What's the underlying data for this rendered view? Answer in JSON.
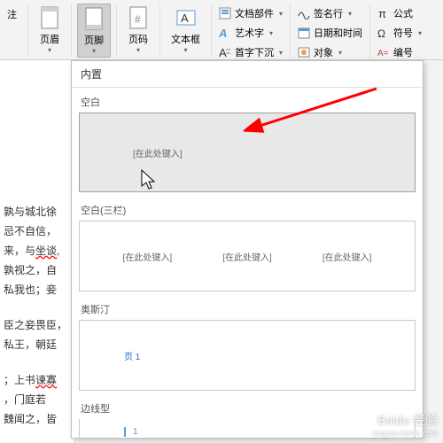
{
  "ribbon": {
    "note_frag": "注",
    "header": "页眉",
    "footer": "页脚",
    "pagenum": "页码",
    "textbox": "文本框",
    "docparts": "文档部件",
    "wordart": "艺术字",
    "dropcap": "首字下沉",
    "signature": "签名行",
    "datetime": "日期和时间",
    "object": "对象",
    "equation": "公式",
    "symbol": "符号",
    "number": "编号"
  },
  "dropdown": {
    "builtin": "内置",
    "blank": "空白",
    "blank3": "空白(三栏)",
    "austin": "奥斯汀",
    "edgeline": "边线型",
    "placeholder": "[在此处键入]",
    "page1": "页 1",
    "num1": "1"
  },
  "doc": {
    "l1": "孰与城北徐",
    "l2": "忌不自信，",
    "l3": "来，与",
    "l3b": "坐谈",
    "l4": "孰视之，自",
    "l5": "私我也；妾",
    "l6": "臣之妾畏臣，",
    "l7": "私王，朝廷",
    "l8": "；上书",
    "l8b": "谏寡",
    "l9": "，门庭若",
    "l10": "魏闻之，皆"
  },
  "watermark": {
    "main": "Baidu 经验",
    "sub": "jingyan.baidu.com"
  }
}
